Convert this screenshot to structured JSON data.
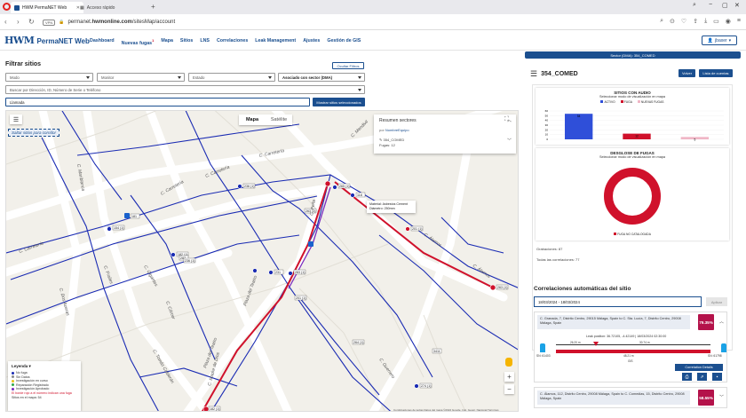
{
  "browser": {
    "active_tab": "HWM PermaNET Web",
    "inactive_tab": "Acceso rápido",
    "vpn": "VPN",
    "url_prefix": "permanet.",
    "url_host": "hwmonline.com",
    "url_path": "/sitesMap/account"
  },
  "header": {
    "logo_mark": "HWM",
    "app_name": "PermaNET Web",
    "nav": [
      {
        "label": "Dashboard"
      },
      {
        "label": "Nuevas fugas",
        "badge": "1",
        "alert": true
      },
      {
        "label": "Mapa"
      },
      {
        "label": "Sitios"
      },
      {
        "label": "LNS"
      },
      {
        "label": "Correlaciones"
      },
      {
        "label": "Leak Management"
      },
      {
        "label": "Ajustes"
      },
      {
        "label": "Gestión de GIS"
      }
    ],
    "user": "jbaxer"
  },
  "filters": {
    "title": "Filtrar sitios",
    "hide_button": "Ocultar Filtros",
    "modo": "Modo",
    "monitor": "Monitor",
    "estado": "Estado",
    "asociado": "Asociado con sector (DMA)",
    "search_placeholder": "Buscar por Dirección, ID, Número de Serie o Teléfono",
    "search_value": "Llamada",
    "show_selected": "Mostrar sitios seleccionados"
  },
  "map": {
    "toggle_map": "Mapa",
    "toggle_sat": "Satélite",
    "jump_label": "Saltar sitios para corridor",
    "summary": {
      "title": "Resumen sectores",
      "por": "por",
      "por_link": "NombreEquipo",
      "sector": "354_COMED",
      "fugas": "Fugas: 12"
    },
    "tooltip_line1": "Material: Asbestos Cement",
    "tooltip_line2": "Diámetro: 250mm",
    "legend": {
      "title": "Leyenda",
      "items": [
        {
          "label": "No fuga",
          "color": "#1a2bb3"
        },
        {
          "label": "Sin Datos",
          "color": "#8b8b8b"
        },
        {
          "label": "Investigación en curso",
          "color": "#e8c21a"
        },
        {
          "label": "Reparación Registrado",
          "color": "#2ea84a"
        },
        {
          "label": "Investigación Aprobado",
          "color": "#7a2cbf"
        }
      ],
      "note": "El borde rojo a el número indican una fuga",
      "count": "Sitios en el mapa: 54"
    },
    "street_labels": [
      "C. Carretería",
      "C. Carretería",
      "C. Carretería",
      "C. Carretería",
      "C. Álamos",
      "C. Álamos",
      "C. Mendivil",
      "Plaza del Teatro",
      "C. Peña",
      "C. Madre de Dios",
      "C. Cárcer",
      "C. Frailes",
      "C. Mariblanca",
      "C. Gigantes",
      "C. Guerrero",
      "C. Tomás Calderón",
      "C. Dos Aceras",
      "Plaza del Teatro"
    ],
    "site_labels": [
      "154 (1)",
      "182 (1)",
      "236 (1)",
      "265 (1)",
      "231",
      "283 (1)",
      "201 (1)",
      "263 (1)",
      "274 (1)",
      "182 (1)",
      "263 (1)",
      "118",
      "287",
      "201 (1)",
      "3411",
      "236 (1)",
      "181",
      "264 (1)"
    ],
    "attribution": "Combinaciones de teclas   Datos del mapa ©2024 Google, Inst. Geogr. Nacional   Términos"
  },
  "right": {
    "sector_bar": "Sector (DMA): 354_COMED",
    "sector_title": "354_COMED",
    "view_btn": "Volver",
    "list_btn": "Lista de cuentas",
    "audio_chart": {
      "title": "SITIOS CON AUDIO",
      "subtitle": "Seleccionar modo de visualización en mapa"
    },
    "breakdown": {
      "title": "DESGLOSE DE FUGAS",
      "subtitle": "Seleccionar modo de visualización en mapa",
      "legend": "FUGA NO CATALOGADA"
    },
    "grabaciones": "Grabaciones: 87",
    "correlaciones": "Todas las correlaciones: 77",
    "corr_title": "Correlaciones automáticas del sitio",
    "date_range": "18/03/2024 - 18/03/2024",
    "date_btn": "Aplicar",
    "corr1": {
      "address": "C. Granada, 7, Distrito Centro, 29015 Málaga, Spain to C. Sta. Lucía, 7, Distrito Centro, 29008 Málaga, Spain",
      "percent": "79.35%",
      "leak_pos": "Leak position: 36.72105, -4.42149  |  18/03/2024 02:30:00",
      "left_id": "SN: 61403",
      "right_id": "SN: 61798",
      "left_dist": "26.20 m",
      "mid_dist": "30.74 m",
      "under_dist": "48.21 m",
      "pipe_label": "GIS",
      "btn": "Correlation Details"
    },
    "corr2": {
      "address": "C. Álamos, 112, Distrito Centro, 29008 Málaga, Spain to C. Comedias, 15, Distrito Centro, 29008 Málaga, Spain",
      "percent": "58.55%"
    }
  },
  "chart_data": [
    {
      "type": "bar",
      "title": "SITIOS CON AUDIO",
      "categories": [
        "ACTIVO",
        "FUGA",
        "NUEVAS FUGAS"
      ],
      "values": [
        54,
        12,
        5
      ],
      "ylim": [
        0,
        60
      ],
      "yticks": [
        0,
        10,
        20,
        30,
        40,
        50,
        60
      ],
      "colors": [
        "#2f4fd9",
        "#d0112b",
        "#f0b6c6"
      ],
      "legend": "top-center"
    },
    {
      "type": "pie",
      "title": "DESGLOSE DE FUGAS",
      "labels": [
        "FUGA NO CATALOGADA"
      ],
      "values": [
        12
      ],
      "colors": [
        "#d0112b"
      ],
      "donut": true
    }
  ]
}
